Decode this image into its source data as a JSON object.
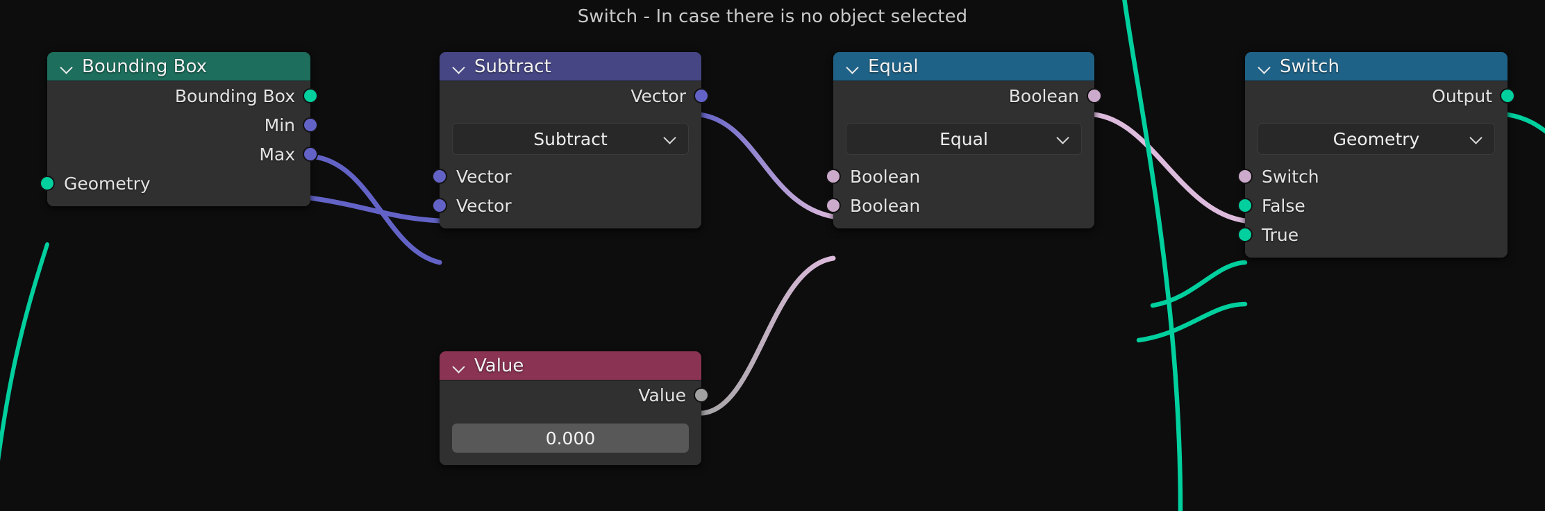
{
  "title": "Switch - In case there is no object selected",
  "colors": {
    "background": "#0d0d0d",
    "node_body": "#303030",
    "header_geometry": "#1d6e5c",
    "header_vector_math": "#464685",
    "header_boolean": "#1f6287",
    "header_input_value": "#8a3353",
    "socket_geometry": "#00cf9e",
    "socket_vector": "#6363c7",
    "socket_boolean": "#ccaacc",
    "socket_float": "#a1a1a1"
  },
  "nodes": [
    {
      "id": "bounding-box",
      "name": "Bounding Box",
      "header_color": "#1d6e5c",
      "outputs": [
        {
          "label": "Bounding Box",
          "socket": "geometry",
          "color": "#00cf9e"
        },
        {
          "label": "Min",
          "socket": "vector",
          "color": "#6363c7"
        },
        {
          "label": "Max",
          "socket": "vector",
          "color": "#6363c7"
        }
      ],
      "inputs": [
        {
          "label": "Geometry",
          "socket": "geometry",
          "color": "#00cf9e"
        }
      ]
    },
    {
      "id": "subtract",
      "name": "Subtract",
      "header_color": "#464685",
      "outputs": [
        {
          "label": "Vector",
          "socket": "vector",
          "color": "#6363c7"
        }
      ],
      "dropdown": {
        "value": "Subtract"
      },
      "inputs": [
        {
          "label": "Vector",
          "socket": "vector",
          "color": "#6363c7"
        },
        {
          "label": "Vector",
          "socket": "vector",
          "color": "#6363c7"
        }
      ]
    },
    {
      "id": "equal",
      "name": "Equal",
      "header_color": "#1f6287",
      "outputs": [
        {
          "label": "Boolean",
          "socket": "boolean",
          "color": "#ccaacc"
        }
      ],
      "dropdown": {
        "value": "Equal"
      },
      "inputs": [
        {
          "label": "Boolean",
          "socket": "boolean",
          "color": "#ccaacc"
        },
        {
          "label": "Boolean",
          "socket": "boolean",
          "color": "#ccaacc"
        }
      ]
    },
    {
      "id": "switch",
      "name": "Switch",
      "header_color": "#1f6287",
      "outputs": [
        {
          "label": "Output",
          "socket": "geometry",
          "color": "#00cf9e"
        }
      ],
      "dropdown": {
        "value": "Geometry"
      },
      "inputs": [
        {
          "label": "Switch",
          "socket": "boolean",
          "color": "#ccaacc"
        },
        {
          "label": "False",
          "socket": "geometry",
          "color": "#00cf9e"
        },
        {
          "label": "True",
          "socket": "geometry",
          "color": "#00cf9e"
        }
      ]
    },
    {
      "id": "value",
      "name": "Value",
      "header_color": "#8a3353",
      "outputs": [
        {
          "label": "Value",
          "socket": "float",
          "color": "#a1a1a1"
        }
      ],
      "field": {
        "value": "0.000"
      }
    }
  ],
  "links": [
    {
      "from": "bounding-box.Max",
      "to": "subtract.Vector1",
      "color_from": "#6363c7",
      "color_to": "#6363c7"
    },
    {
      "from": "bounding-box.Min",
      "to": "subtract.Vector2",
      "color_from": "#6363c7",
      "color_to": "#6363c7"
    },
    {
      "from": "subtract.Vector",
      "to": "equal.Boolean1",
      "color_from": "#6363c7",
      "color_to": "#ccaacc"
    },
    {
      "from": "value.Value",
      "to": "equal.Boolean2",
      "color_from": "#a1a1a1",
      "color_to": "#ccaacc"
    },
    {
      "from": "equal.Boolean",
      "to": "switch.Switch",
      "color_from": "#ccaacc",
      "color_to": "#ccaacc"
    },
    {
      "from": "offscreen.geometry",
      "to": "switch.False",
      "color_from": "#00cf9e",
      "color_to": "#00cf9e"
    },
    {
      "from": "offscreen.geometry",
      "to": "switch.True",
      "color_from": "#00cf9e",
      "color_to": "#00cf9e"
    },
    {
      "from": "offscreen.geometry",
      "to": "bounding-box.Geometry",
      "color_from": "#00cf9e",
      "color_to": "#00cf9e"
    },
    {
      "from": "switch.Output",
      "to": "offscreen.right",
      "color_from": "#00cf9e",
      "color_to": "#00cf9e"
    }
  ]
}
